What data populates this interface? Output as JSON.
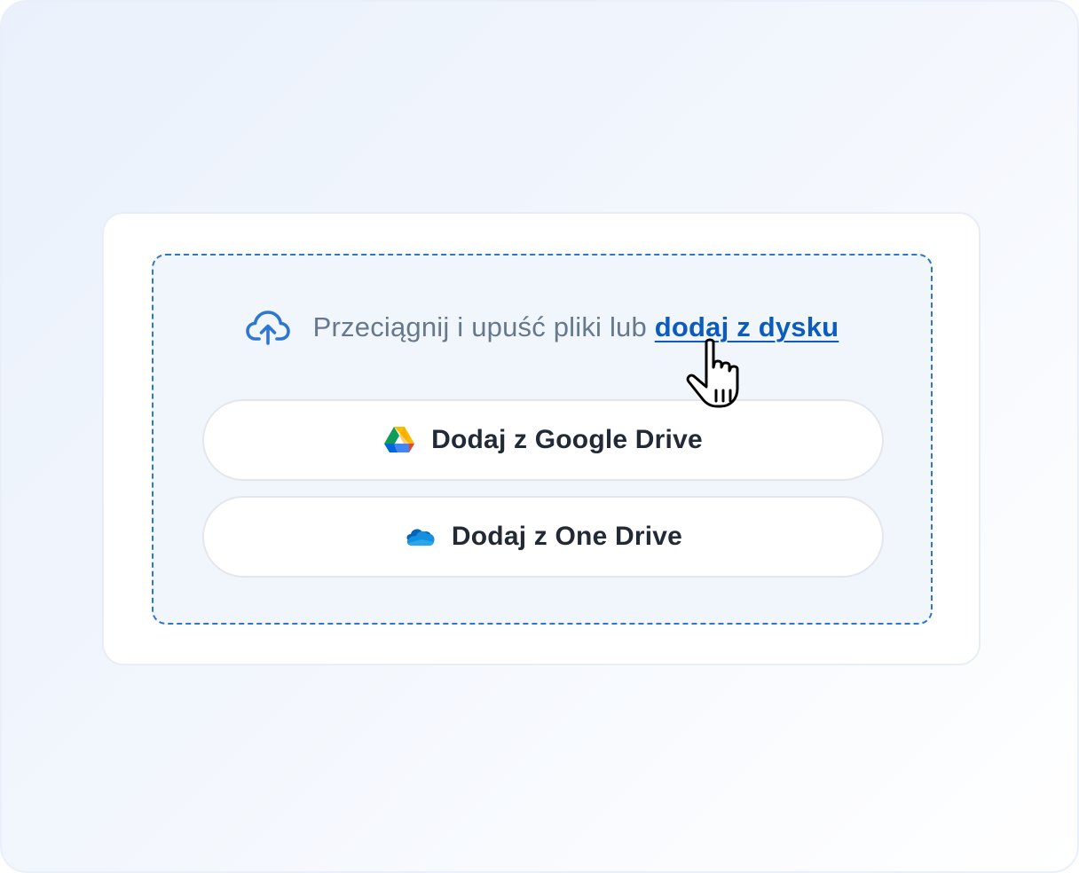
{
  "uploader": {
    "prompt_text": "Przeciągnij i upuść pliki lub ",
    "browse_link": "dodaj z dysku",
    "upload_icon": "cloud-upload-icon",
    "accent_color": "#0b5cbd",
    "dropzone_border_color": "#2d77d1"
  },
  "buttons": {
    "google_drive_label": "Dodaj z Google Drive",
    "google_drive_icon": "google-drive-icon",
    "onedrive_label": "Dodaj z One Drive",
    "onedrive_icon": "onedrive-icon"
  },
  "pointer": {
    "icon": "hand-pointer-cursor"
  }
}
